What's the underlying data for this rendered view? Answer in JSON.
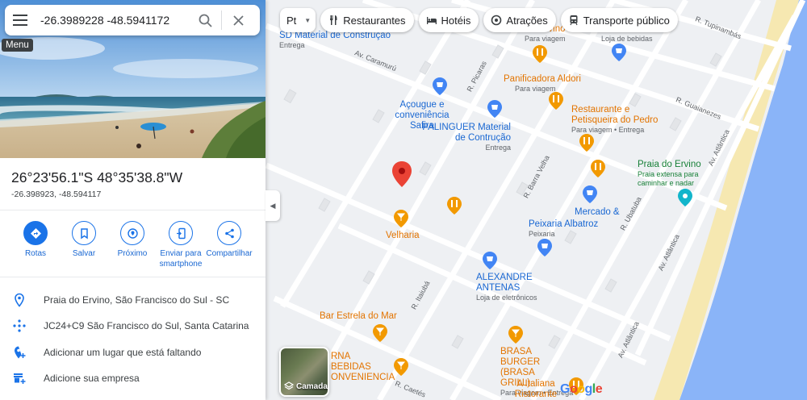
{
  "search": {
    "value": "-26.3989228 -48.5941172",
    "tooltip": "Menu"
  },
  "place": {
    "dms": "26°23'56.1\"S 48°35'38.8\"W",
    "decimal": "-26.398923, -48.594117"
  },
  "actions": [
    {
      "label": "Rotas",
      "icon": "directions-icon"
    },
    {
      "label": "Salvar",
      "icon": "bookmark-icon"
    },
    {
      "label": "Próximo",
      "icon": "nearby-icon"
    },
    {
      "label": "Enviar para smartphone",
      "icon": "send-to-phone-icon"
    },
    {
      "label": "Compartilhar",
      "icon": "share-icon"
    }
  ],
  "info_rows": [
    {
      "text": "Praia do Ervino, São Francisco do Sul - SC",
      "icon": "location-pin-icon"
    },
    {
      "text": "JC24+C9 São Francisco do Sul, Santa Catarina",
      "icon": "plus-code-icon"
    },
    {
      "text": "Adicionar um lugar que está faltando",
      "icon": "add-place-icon"
    },
    {
      "text": "Adicione sua empresa",
      "icon": "add-business-icon"
    }
  ],
  "chips": {
    "language": "Pt",
    "items": [
      {
        "label": "Restaurantes",
        "icon": "restaurant-icon"
      },
      {
        "label": "Hotéis",
        "icon": "hotel-icon"
      },
      {
        "label": "Atrações",
        "icon": "attractions-icon"
      },
      {
        "label": "Transporte público",
        "icon": "transit-icon"
      }
    ]
  },
  "layers": {
    "label": "Camadas"
  },
  "map": {
    "pois": [
      {
        "name": "SD Material de Construção",
        "sub": "Entrega",
        "kind": "blue"
      },
      {
        "name": "Açougue e conveniência Safira",
        "kind": "blue"
      },
      {
        "name": "PALINGUER Material de Contrução",
        "sub": "Entrega",
        "kind": "blue"
      },
      {
        "name": "Panificadora Aldori",
        "sub": "Para viagem",
        "kind": "orange"
      },
      {
        "name": "Restaurante e Petisqueira do Pedro",
        "sub": "Para viagem • Entrega",
        "kind": "orange"
      },
      {
        "name": "Praia do Ervino",
        "sub": "Praia extensa para caminhar e nadar",
        "kind": "teal"
      },
      {
        "name": "Mercado &",
        "kind": "blue"
      },
      {
        "name": "Peixaria Albatroz",
        "sub": "Peixaria",
        "kind": "blue"
      },
      {
        "name": "Velharia",
        "kind": "orange"
      },
      {
        "name": "ALEXANDRE ANTENAS",
        "sub": "Loja de eletrônicos",
        "kind": "blue"
      },
      {
        "name": "Bar Estrela do Mar",
        "kind": "orange"
      },
      {
        "name": "RNA BEBIDAS ONVENIENCIA",
        "kind": "orange"
      },
      {
        "name": "BRASA BURGER (BRASA GRILL)",
        "sub": "Para viagem • Entrega",
        "kind": "orange"
      },
      {
        "name": "A Italiana Ristorante Italiano",
        "kind": "orange"
      },
      {
        "name": "de conveniencia",
        "sub": "Loja de bebidas",
        "kind": "blue"
      },
      {
        "name": "Do Ervino",
        "sub": "Para viagem",
        "kind": "orange"
      }
    ],
    "streets": [
      "Av. Caramurú",
      "R. Picaras",
      "R. Barra Velha",
      "R. Ubatuba",
      "R. Guaianezes",
      "R. Tupinambás",
      "Av. Atlântica",
      "Av. Atlântica",
      "Av. Atlântica",
      "R. Itaiubá",
      "R. Caetés"
    ],
    "logo": "Google"
  }
}
